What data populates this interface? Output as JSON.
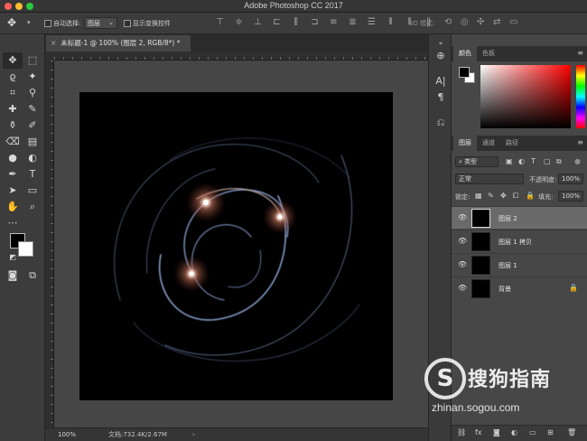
{
  "window": {
    "title": "Adobe Photoshop CC 2017"
  },
  "options_bar": {
    "auto_select_label": "自动选择:",
    "auto_select_value": "图层",
    "show_transform_label": "显示变换控件",
    "mode_3d_label": "3D 模式:"
  },
  "document": {
    "tab_title": "未标题-1 @ 100% (图层 2, RGB/8*) *",
    "zoom": "100%",
    "doc_size": "文档:732.4K/2.67M"
  },
  "color_panel": {
    "tabs": [
      "颜色",
      "色板"
    ],
    "foreground": "#000000",
    "background": "#ffffff"
  },
  "layers_panel": {
    "tabs": [
      "图层",
      "通道",
      "路径"
    ],
    "filter_kind": "类型",
    "blend_mode": "正常",
    "opacity_label": "不透明度:",
    "opacity_value": "100%",
    "lock_label": "锁定:",
    "fill_label": "填充:",
    "fill_value": "100%",
    "layers": [
      {
        "name": "图层 2",
        "selected": true,
        "locked": false
      },
      {
        "name": "图层 1 拷贝",
        "selected": false,
        "locked": false
      },
      {
        "name": "图层 1",
        "selected": false,
        "locked": false
      },
      {
        "name": "背景",
        "selected": false,
        "locked": true
      }
    ]
  },
  "watermark": {
    "logo_letter": "S",
    "brand": "搜狗指南",
    "url": "zhinan.sogou.com"
  }
}
